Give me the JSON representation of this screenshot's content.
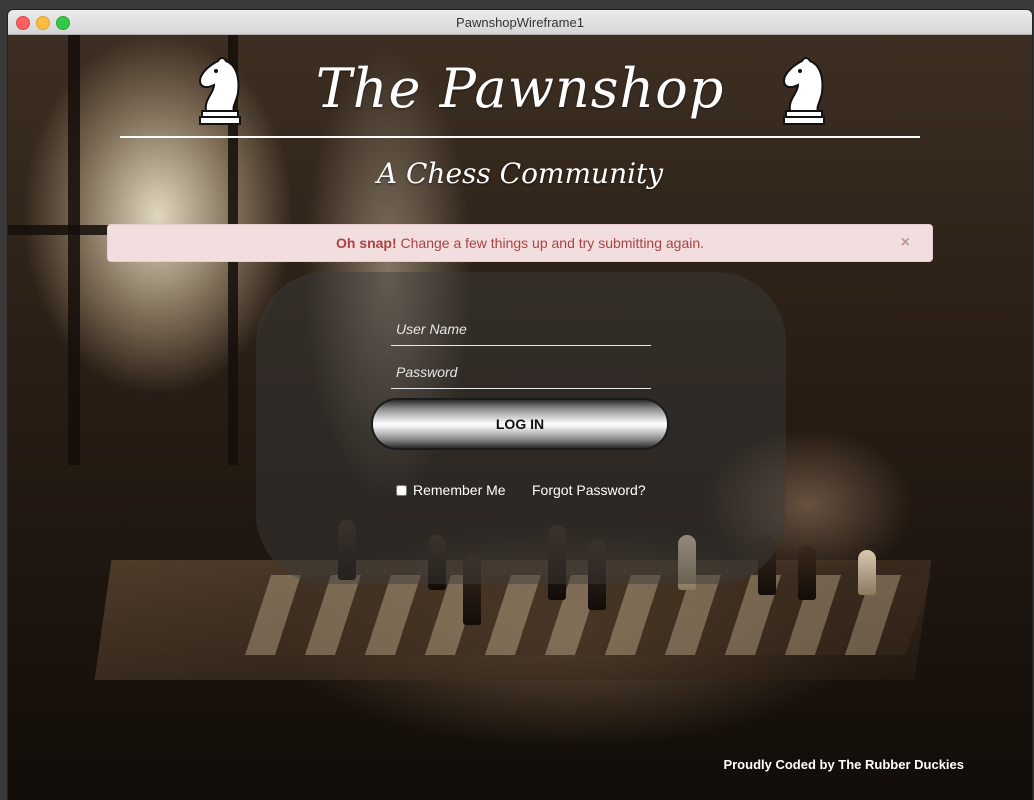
{
  "window": {
    "title": "PawnshopWireframe1"
  },
  "header": {
    "title": "The Pawnshop",
    "subtitle": "A Chess Community",
    "logo_icon": "knight-icon"
  },
  "alert": {
    "strong": "Oh snap!",
    "message": " Change a few things up and try submitting again.",
    "close": "×",
    "background": "#f2dede",
    "color": "#a94442"
  },
  "login": {
    "username_placeholder": "User Name",
    "password_placeholder": "Password",
    "button_label": "LOG IN",
    "remember_label": "Remember Me",
    "forgot_label": "Forgot Password?"
  },
  "footer": {
    "credit": "Proudly Coded by The Rubber Duckies"
  }
}
